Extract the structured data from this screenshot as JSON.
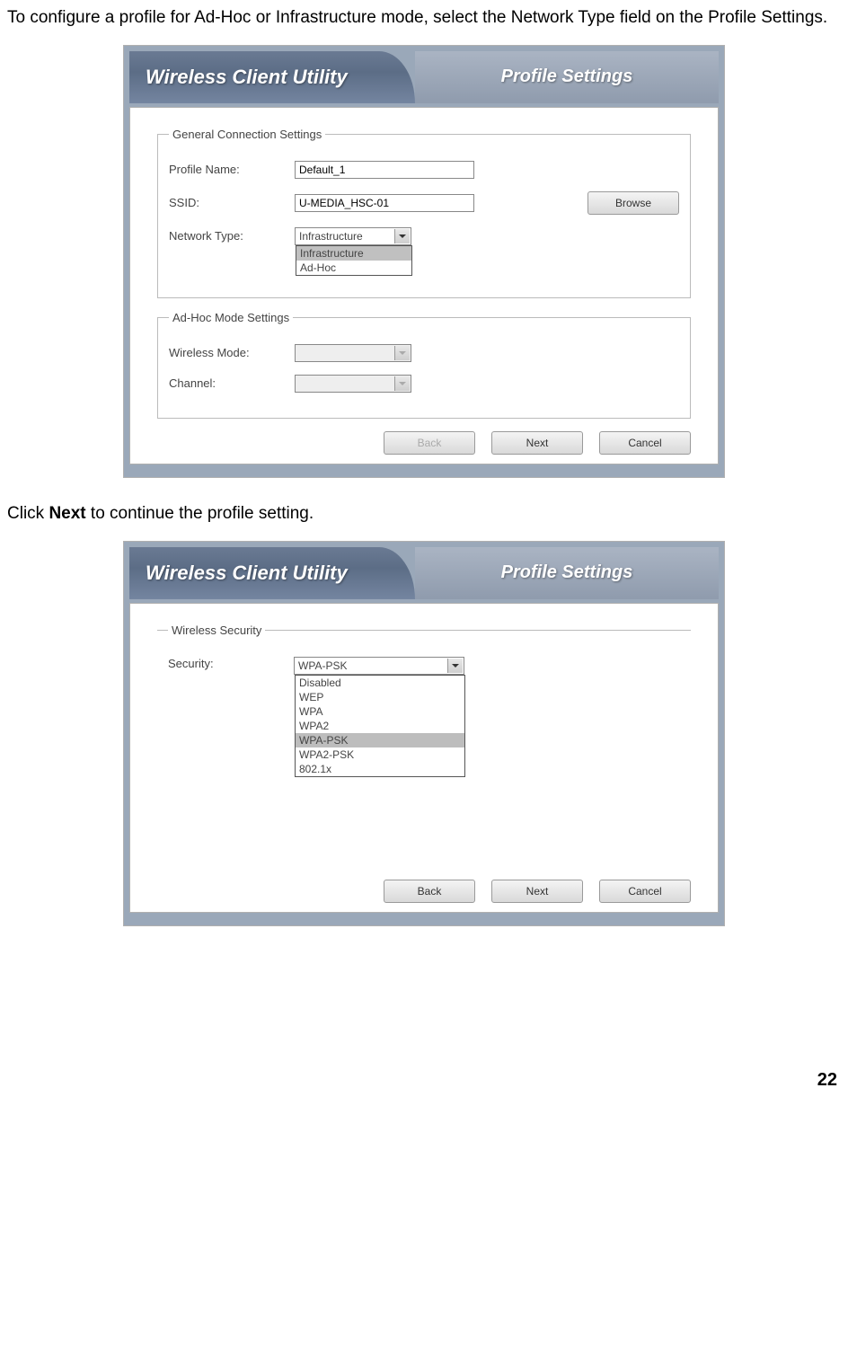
{
  "intro1": "To configure a profile for Ad-Hoc or Infrastructure mode, select the Network Type field on the Profile Settings.",
  "intro2_prefix": "Click ",
  "intro2_bold": "Next",
  "intro2_suffix": " to continue the profile setting.",
  "page_number": "22",
  "panel1": {
    "app_title": "Wireless Client Utility",
    "tab_title": "Profile Settings",
    "general": {
      "legend": "General Connection Settings",
      "profile_name_label": "Profile Name:",
      "profile_name_value": "Default_1",
      "ssid_label": "SSID:",
      "ssid_value": "U-MEDIA_HSC-01",
      "browse": "Browse",
      "network_type_label": "Network Type:",
      "network_type_value": "Infrastructure",
      "network_type_options": [
        "Infrastructure",
        "Ad-Hoc"
      ]
    },
    "adhoc": {
      "legend": "Ad-Hoc Mode Settings",
      "wireless_mode_label": "Wireless Mode:",
      "channel_label": "Channel:"
    },
    "buttons": {
      "back": "Back",
      "next": "Next",
      "cancel": "Cancel"
    }
  },
  "panel2": {
    "app_title": "Wireless Client Utility",
    "tab_title": "Profile Settings",
    "security": {
      "legend": "Wireless Security",
      "security_label": "Security:",
      "security_value": "WPA-PSK",
      "security_options": [
        "Disabled",
        "WEP",
        "WPA",
        "WPA2",
        "WPA-PSK",
        "WPA2-PSK",
        "802.1x"
      ]
    },
    "buttons": {
      "back": "Back",
      "next": "Next",
      "cancel": "Cancel"
    }
  }
}
